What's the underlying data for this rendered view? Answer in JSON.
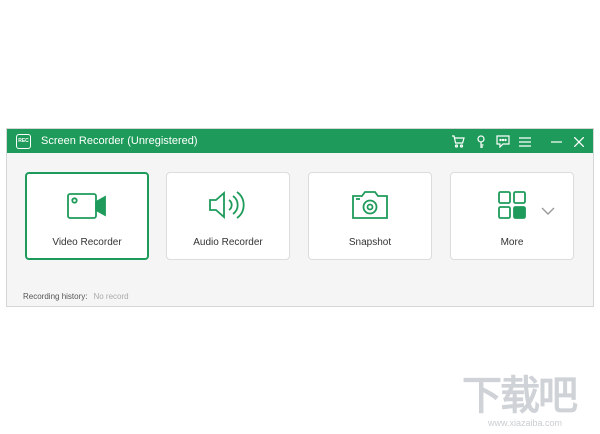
{
  "window": {
    "title": "Screen Recorder (Unregistered)",
    "logo_text": "REC",
    "accent": "#1e9b5a",
    "titlebar_icons": [
      "cart-icon",
      "key-icon",
      "chat-icon",
      "menu-icon",
      "minimize-icon",
      "close-icon"
    ]
  },
  "tiles": {
    "video": {
      "label": "Video Recorder",
      "icon": "video-camera-icon",
      "selected": true
    },
    "audio": {
      "label": "Audio Recorder",
      "icon": "speaker-icon"
    },
    "snapshot": {
      "label": "Snapshot",
      "icon": "camera-icon"
    },
    "more": {
      "label": "More",
      "icon": "grid-icon",
      "dropdown_icon": "chevron-down-icon"
    }
  },
  "history": {
    "label": "Recording history:",
    "value": "No record"
  },
  "watermark": {
    "text": "下载吧",
    "url": "www.xiazaiba.com"
  }
}
